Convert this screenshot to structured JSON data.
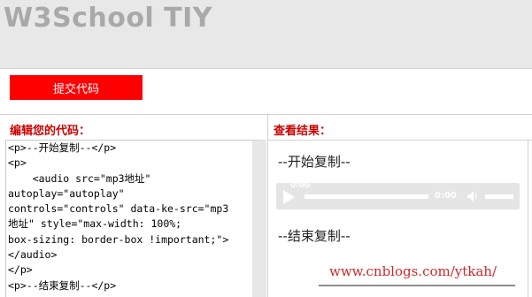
{
  "header": {
    "title": "W3School TIY"
  },
  "toolbar": {
    "submit_label": "提交代码"
  },
  "panels": {
    "left_heading": "编辑您的代码：",
    "right_heading": "查看结果："
  },
  "editor": {
    "code": "<p>--开始复制--</p>\n<p>\n    <audio src=\"mp3地址\"\nautoplay=\"autoplay\"\ncontrols=\"controls\" data-ke-src=\"mp3\n地址\" style=\"max-width: 100%;\nbox-sizing: border-box !important;\">\n</audio>\n</p>\n<p>--结束复制--</p>"
  },
  "result": {
    "start_text": "--开始复制--",
    "end_text": "--结束复制--",
    "player": {
      "current_time": "0:00",
      "duration": "0:00",
      "icon_play": "play-icon",
      "icon_volume": "volume-icon"
    }
  },
  "watermark": {
    "text": "www.cnblogs.com/ytkah/"
  },
  "colors": {
    "accent": "#ff0000",
    "heading": "#cc0000",
    "header_bg": "#e8e8e8"
  }
}
